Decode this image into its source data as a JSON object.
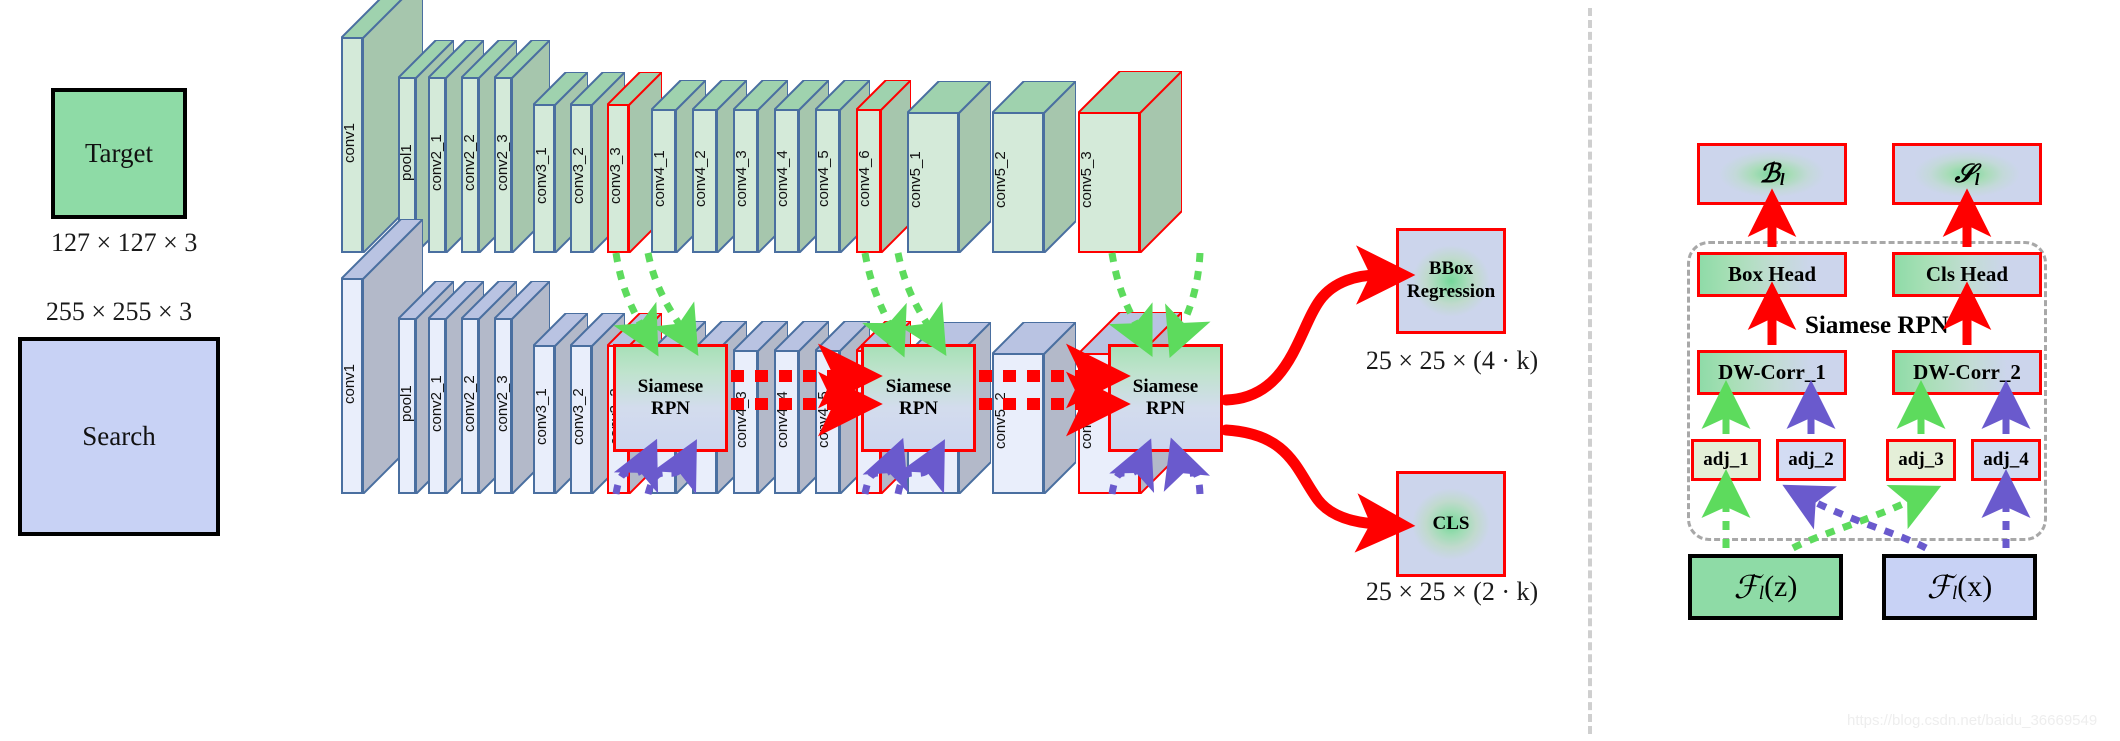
{
  "colors": {
    "red": "#ff0000",
    "green_arrow": "#5ddb5d",
    "purple_arrow": "#6a5acd",
    "slab_outline": "#4a6fa0",
    "target_fill": "#8edba6",
    "search_fill": "#c8d2f5",
    "divider": "#cfcfcf"
  },
  "left_panel": {
    "target": {
      "label": "Target",
      "dims": "127 × 127 × 3"
    },
    "search": {
      "label": "Search",
      "dims": "255 × 255 × 3"
    },
    "conv_labels": [
      "conv1",
      "pool1",
      "conv2_1",
      "conv2_2",
      "conv2_3",
      "conv3_1",
      "conv3_2",
      "conv3_3",
      "conv4_1",
      "conv4_2",
      "conv4_3",
      "conv4_4",
      "conv4_5",
      "conv4_6",
      "conv5_1",
      "conv5_2",
      "conv5_3"
    ],
    "highlighted_layers": [
      "conv3_3",
      "conv4_6",
      "conv5_3"
    ],
    "rpn_blocks": [
      {
        "line1": "Siamese",
        "line2": "RPN"
      },
      {
        "line1": "Siamese",
        "line2": "RPN"
      },
      {
        "line1": "Siamese",
        "line2": "RPN"
      }
    ],
    "outputs": [
      {
        "line1": "BBox",
        "line2": "Regression",
        "dims": "25 × 25 × (4 · k)"
      },
      {
        "line1": "CLS",
        "line2": "",
        "dims": "25 × 25 × (2 · k)"
      }
    ]
  },
  "right_panel": {
    "group_label": "Siamese RPN",
    "top_outputs": [
      {
        "label": "B",
        "sub": "l"
      },
      {
        "label": "S",
        "sub": "l"
      }
    ],
    "heads": [
      "Box Head",
      "Cls Head"
    ],
    "corr": [
      "DW-Corr_1",
      "DW-Corr_2"
    ],
    "adj": [
      "adj_1",
      "adj_2",
      "adj_3",
      "adj_4"
    ],
    "features": [
      {
        "fn": "F",
        "sub": "l",
        "arg": "(z)"
      },
      {
        "fn": "F",
        "sub": "l",
        "arg": "(x)"
      }
    ]
  },
  "watermark": "https://blog.csdn.net/baidu_36669549"
}
